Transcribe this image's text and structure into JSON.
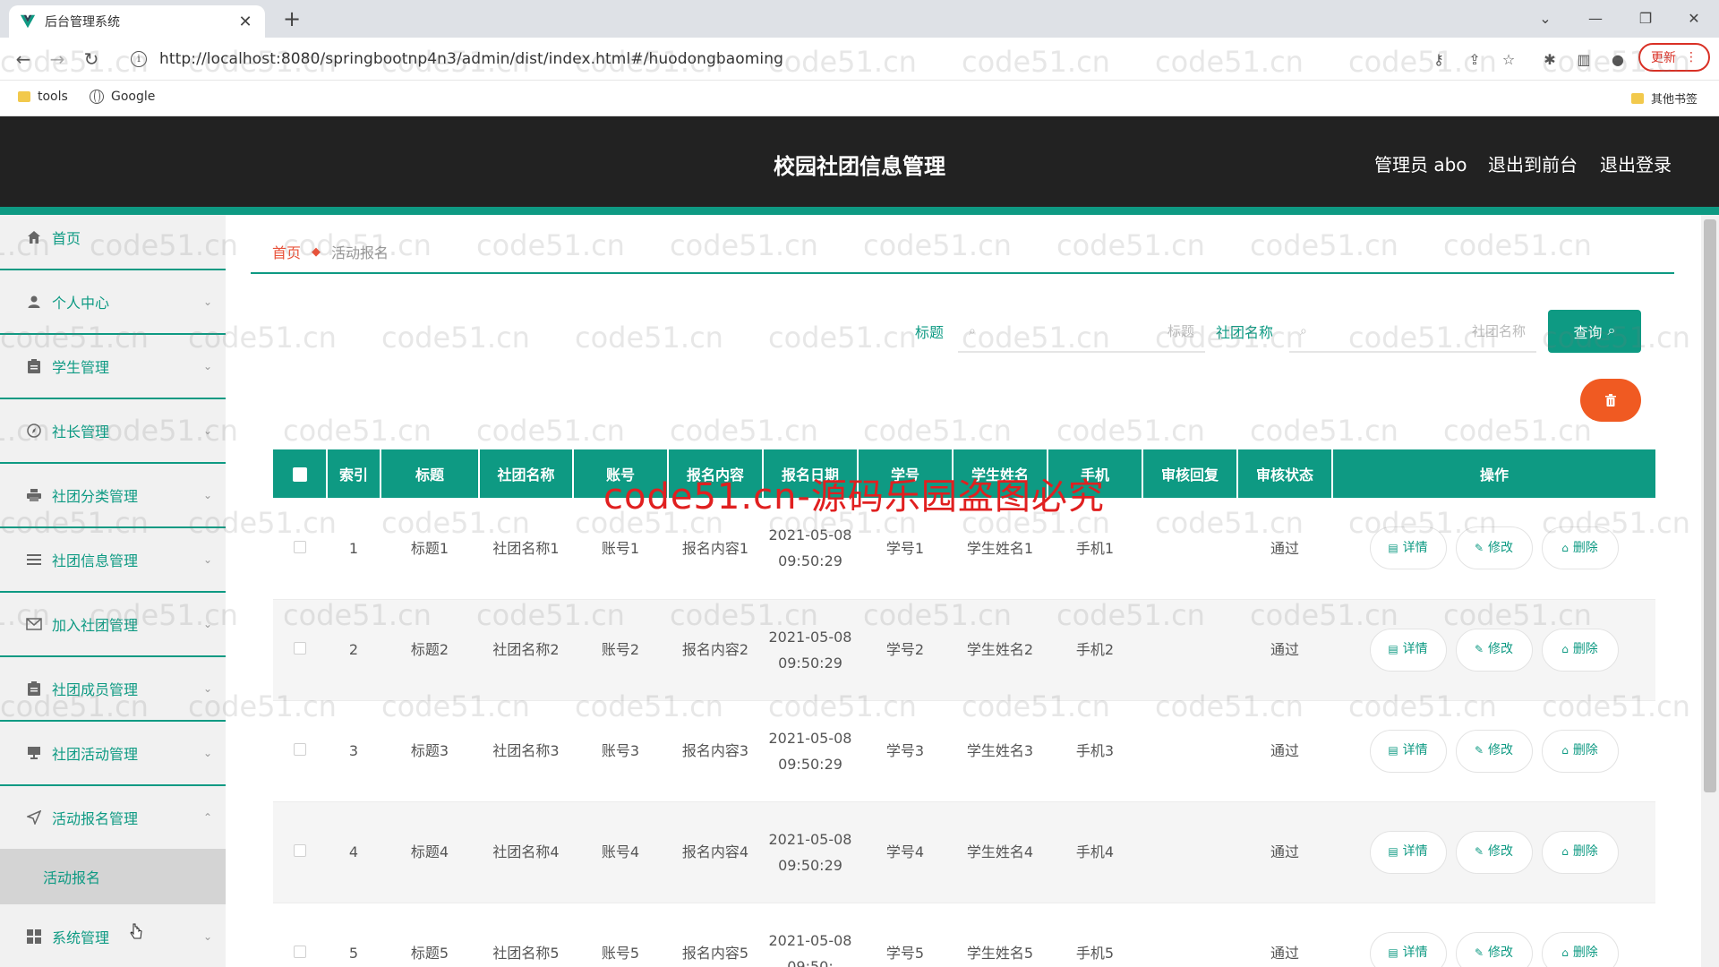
{
  "browser": {
    "tab_title": "后台管理系统",
    "tab_close": "✕",
    "new_tab": "+",
    "url": "http://localhost:8080/springbootnp4n3/admin/dist/index.html#/huodongbaoming",
    "update_label": "更新",
    "bookmarks": [
      "tools",
      "Google"
    ],
    "other_bookmarks": "其他书签"
  },
  "header": {
    "title": "校园社团信息管理",
    "admin": "管理员 abo",
    "to_front": "退出到前台",
    "logout": "退出登录"
  },
  "sidebar": {
    "items": [
      {
        "label": "首页",
        "icon": "home-icon",
        "arrow": ""
      },
      {
        "label": "个人中心",
        "icon": "user-icon",
        "arrow": "⌄"
      },
      {
        "label": "学生管理",
        "icon": "clipboard-icon",
        "arrow": "⌄"
      },
      {
        "label": "社长管理",
        "icon": "compass-icon",
        "arrow": "⌄"
      },
      {
        "label": "社团分类管理",
        "icon": "printer-icon",
        "arrow": "⌄"
      },
      {
        "label": "社团信息管理",
        "icon": "list-icon",
        "arrow": "⌄"
      },
      {
        "label": "加入社团管理",
        "icon": "mail-icon",
        "arrow": "⌄"
      },
      {
        "label": "社团成员管理",
        "icon": "document-icon",
        "arrow": "⌄"
      },
      {
        "label": "社团活动管理",
        "icon": "monitor-icon",
        "arrow": "⌄"
      },
      {
        "label": "活动报名管理",
        "icon": "send-icon",
        "arrow": "⌃"
      },
      {
        "label": "系统管理",
        "icon": "grid-icon",
        "arrow": "⌄"
      }
    ],
    "active_sub": "活动报名"
  },
  "breadcrumb": {
    "home": "首页",
    "current": "活动报名"
  },
  "search": {
    "title_label": "标题",
    "title_placeholder": "标题",
    "club_label": "社团名称",
    "club_placeholder": "社团名称",
    "query_button": "查询"
  },
  "table": {
    "headers": [
      "索引",
      "标题",
      "社团名称",
      "账号",
      "报名内容",
      "报名日期",
      "学号",
      "学生姓名",
      "手机",
      "审核回复",
      "审核状态",
      "操作"
    ],
    "actions": {
      "detail": "详情",
      "edit": "修改",
      "delete": "删除"
    },
    "rows": [
      {
        "index": "1",
        "title": "标题1",
        "club": "社团名称1",
        "account": "账号1",
        "content": "报名内容1",
        "date": "2021-05-08 09:50:29",
        "student_no": "学号1",
        "student_name": "学生姓名1",
        "phone": "手机1",
        "reply": "",
        "status": "通过"
      },
      {
        "index": "2",
        "title": "标题2",
        "club": "社团名称2",
        "account": "账号2",
        "content": "报名内容2",
        "date": "2021-05-08 09:50:29",
        "student_no": "学号2",
        "student_name": "学生姓名2",
        "phone": "手机2",
        "reply": "",
        "status": "通过"
      },
      {
        "index": "3",
        "title": "标题3",
        "club": "社团名称3",
        "account": "账号3",
        "content": "报名内容3",
        "date": "2021-05-08 09:50:29",
        "student_no": "学号3",
        "student_name": "学生姓名3",
        "phone": "手机3",
        "reply": "",
        "status": "通过"
      },
      {
        "index": "4",
        "title": "标题4",
        "club": "社团名称4",
        "account": "账号4",
        "content": "报名内容4",
        "date": "2021-05-08 09:50:29",
        "student_no": "学号4",
        "student_name": "学生姓名4",
        "phone": "手机4",
        "reply": "",
        "status": "通过"
      },
      {
        "index": "5",
        "title": "标题5",
        "club": "社团名称5",
        "account": "账号5",
        "content": "报名内容5",
        "date": "2021-05-08 09:50:",
        "student_no": "学号5",
        "student_name": "学生姓名5",
        "phone": "手机5",
        "reply": "",
        "status": "通过"
      }
    ]
  },
  "watermark": {
    "text": "code51.cn",
    "red_text": "code51.cn-源码乐园盗图必究"
  },
  "colors": {
    "accent": "#0e9a83",
    "header_bg": "#222222",
    "danger": "#f05a22",
    "breadcrumb_home": "#e8523a"
  }
}
